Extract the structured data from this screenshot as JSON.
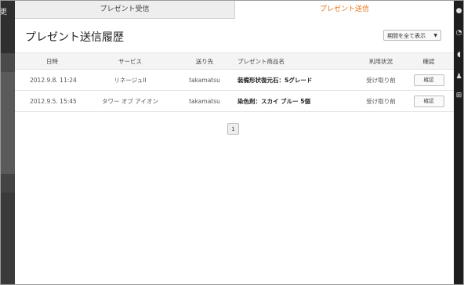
{
  "left_edge_text": "更",
  "tabs": [
    {
      "label": "プレゼント受信"
    },
    {
      "label": "プレゼント送信"
    }
  ],
  "title": "プレゼント送信履歴",
  "filter": {
    "selected": "期間を全て表示"
  },
  "table": {
    "headers": [
      "日時",
      "サービス",
      "送り先",
      "プレゼント商品名",
      "利用状況",
      "確認"
    ],
    "rows": [
      {
        "date": "2012.9.8. 11:24",
        "service": "リネージュII",
        "to": "takamatsu",
        "item": "装備形状復元石：Sグレード",
        "status": "受け取り前",
        "confirm": "確認"
      },
      {
        "date": "2012.9.5. 15:45",
        "service": "タワー オブ アイオン",
        "to": "takamatsu",
        "item": "染色剤：スカイ ブルー 5個",
        "status": "受け取り前",
        "confirm": "確認"
      }
    ]
  },
  "pagination": {
    "current": "1"
  },
  "right_toolbar_icons": [
    "info-icon",
    "clock-icon",
    "chat-icon",
    "user-icon",
    "cart-icon"
  ]
}
